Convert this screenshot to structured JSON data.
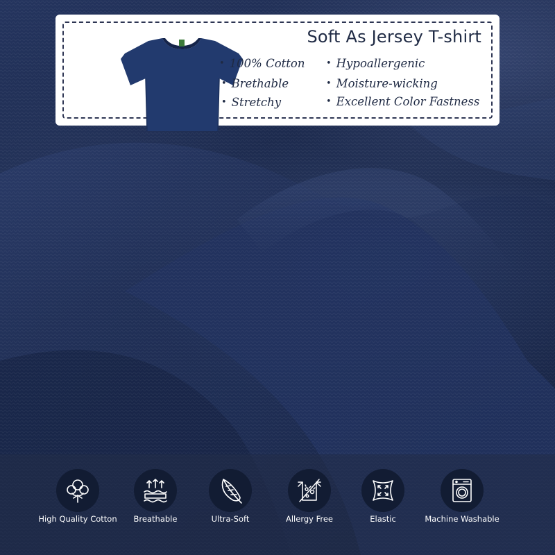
{
  "card": {
    "title": "Soft As Jersey T-shirt",
    "features_left": [
      "100% Cotton",
      "Brethable",
      "Stretchy"
    ],
    "features_right": [
      "Hypoallergenic",
      "Moisture-wicking",
      "Excellent Color Fastness"
    ]
  },
  "icons": [
    {
      "label": "High Quality Cotton",
      "icon": "cotton-flower-icon"
    },
    {
      "label": "Breathable",
      "icon": "breathable-layers-icon"
    },
    {
      "label": "Ultra-Soft",
      "icon": "feather-icon"
    },
    {
      "label": "Allergy Free",
      "icon": "allergy-free-icon"
    },
    {
      "label": "Elastic",
      "icon": "elastic-stretch-icon"
    },
    {
      "label": "Machine Washable",
      "icon": "washing-machine-icon"
    }
  ],
  "colors": {
    "fabric": "#1c2b50",
    "shirt": "#223a6e",
    "card_text": "#1f2a44",
    "icon_circle": "#121c33"
  }
}
